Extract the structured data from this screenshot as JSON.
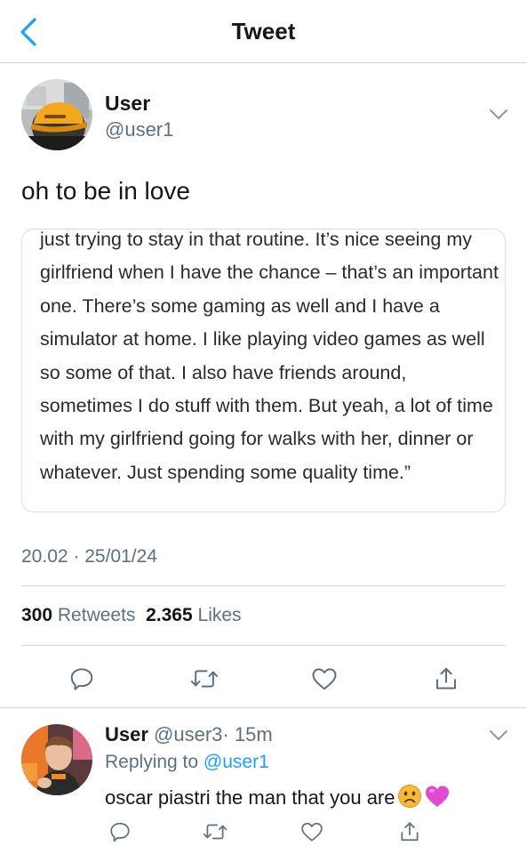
{
  "navbar": {
    "title": "Tweet",
    "back_icon": "chevron-left-icon"
  },
  "tweet": {
    "author_name": "User",
    "author_handle": "@user1",
    "text": "oh to be in love",
    "quote_text": "just trying to stay in that routine. It’s nice seeing my girlfriend when I have the chance – that’s an important one. There’s some gaming as well and I have a simulator at home. I like playing video games as well so some of that. I also have friends around, sometimes I do stuff with them. But yeah, a lot of time with my girlfriend going for walks with her, dinner or whatever. Just spending some quality time.”",
    "timestamp": "20.02 · 25/01/24",
    "retweets_count": "300",
    "retweets_label": "Retweets",
    "likes_count": "2.365",
    "likes_label": "Likes"
  },
  "reply": {
    "author_name": "User",
    "author_handle": "@user3",
    "time": "· 15m",
    "replying_label": "Replying to",
    "replying_handle": "@user1",
    "text": "oscar piastri the man that you are",
    "emojis": [
      "frowning-face-emoji",
      "purple-heart-emoji"
    ]
  },
  "icons": [
    "reply-icon",
    "retweet-icon",
    "like-icon",
    "share-icon",
    "chevron-down-icon"
  ],
  "colors": {
    "accent": "#1da1f2",
    "secondary_text": "#5b7083",
    "primary_text": "#14171a",
    "divider": "#d4d8db",
    "heart_emoji": "#e04bd0",
    "frown_emoji": "#f7b93a"
  }
}
